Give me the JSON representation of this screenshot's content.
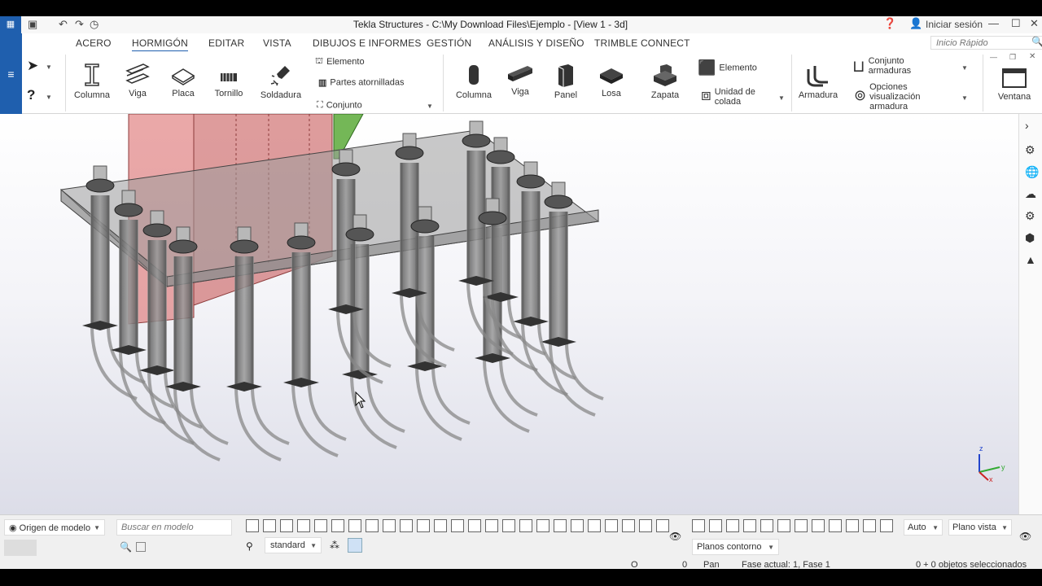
{
  "window": {
    "title": "Tekla Structures - C:\\My Download Files\\Ejemplo  - [View 1 - 3d]",
    "signin": "Iniciar sesión",
    "quick_search_placeholder": "Inicio Rápido"
  },
  "tabs": [
    "ACERO",
    "HORMIGÓN",
    "EDITAR",
    "VISTA",
    "DIBUJOS E INFORMES",
    "GESTIÓN",
    "ANÁLISIS Y DISEÑO",
    "TRIMBLE CONNECT"
  ],
  "active_tab": "HORMIGÓN",
  "ribbon": {
    "steel": {
      "column": "Columna",
      "beam": "Viga",
      "plate": "Placa",
      "bolt": "Tornillo",
      "weld": "Soldadura",
      "element": "Elemento",
      "bolted_parts": "Partes atornilladas",
      "assembly": "Conjunto"
    },
    "concrete": {
      "column": "Columna",
      "beam": "Viga",
      "panel": "Panel",
      "slab": "Losa",
      "footing": "Zapata",
      "element": "Elemento",
      "pour_unit": "Unidad de\ncolada",
      "rebar": "Armadura",
      "rebar_assembly": "Conjunto\narmaduras",
      "rebar_display": "Opciones\nvisualización\narmadura",
      "window": "Ventana"
    }
  },
  "bottom": {
    "origin": "Origen de modelo",
    "search_placeholder": "Buscar en modelo",
    "standard": "standard",
    "auto": "Auto",
    "plane_view": "Plano vista",
    "contour_planes": "Planos contorno"
  },
  "status": {
    "o_label": "O",
    "value": "0",
    "pan": "Pan",
    "phase": "Fase actual: 1, Fase 1",
    "selection": "0 + 0 objetos seleccionados"
  },
  "colors": {
    "accent": "#1f5fae",
    "red_part": "#d96060",
    "green_part": "#5caa3a",
    "concrete": "#8a8a8a"
  }
}
